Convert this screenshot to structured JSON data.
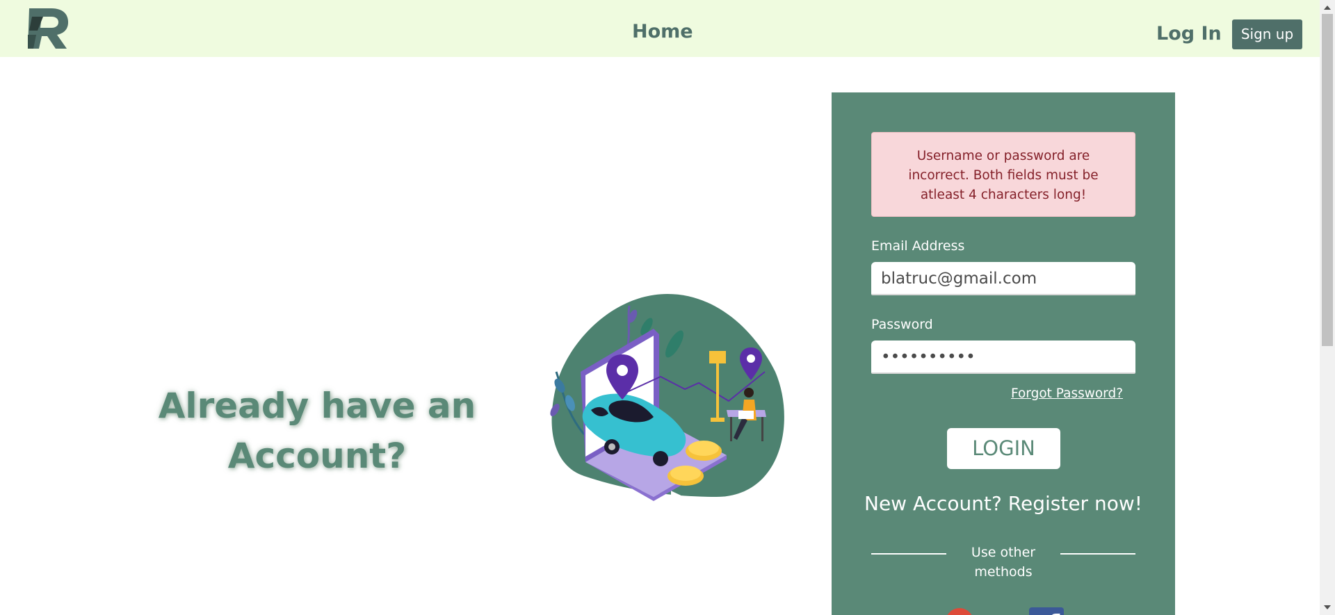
{
  "navbar": {
    "logo_letter": "R",
    "home_label": "Home",
    "login_label": "Log In",
    "signup_label": "Sign up"
  },
  "hero": {
    "headline_line1": "Already have an",
    "headline_line2": "Account?"
  },
  "login_form": {
    "error_message": "Username or password are incorrect. Both fields must be atleast 4 characters long!",
    "email_label": "Email Address",
    "email_value": "blatruc@gmail.com",
    "password_label": "Password",
    "password_value": "••••••••••",
    "forgot_password_label": "Forgot Password?",
    "login_button_label": "LOGIN",
    "register_label": "New Account? Register now!",
    "other_methods_label": "Use other methods",
    "social_icons": [
      "google-icon",
      "facebook-icon"
    ]
  },
  "colors": {
    "navbar_bg": "#effbdf",
    "brand_dark": "#4f6f69",
    "panel_bg": "#5a8977",
    "alert_bg": "#f8d7da",
    "alert_text": "#842029"
  }
}
